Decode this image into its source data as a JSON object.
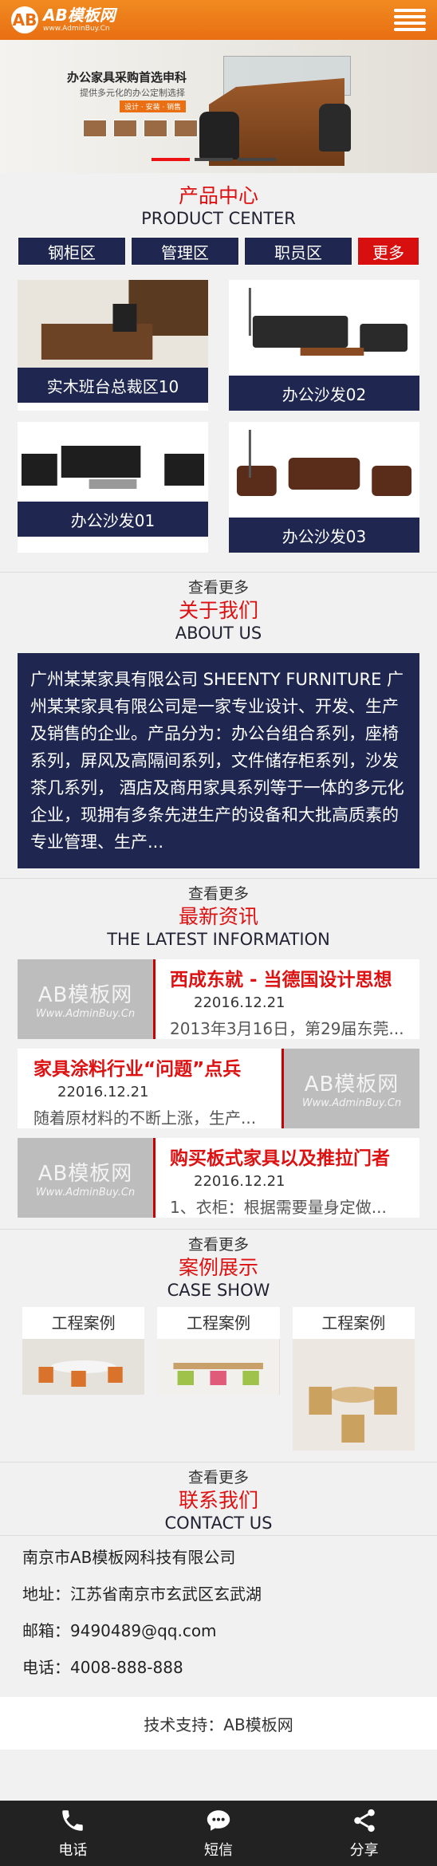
{
  "header": {
    "logo_mark": "AB",
    "logo_title": "AB模板网",
    "logo_sub": "www.AdminBuy.Cn"
  },
  "banner": {
    "title": "办公家具采购首选申科",
    "subtitle": "提供多元化的办公定制选择",
    "tag": "设计 · 安装 · 销售"
  },
  "products": {
    "title_cn": "产品中心",
    "title_en": "PRODUCT CENTER",
    "categories": [
      "钢柜区",
      "管理区",
      "职员区"
    ],
    "more_label": "更多",
    "items": [
      {
        "caption": "实木班台总裁区10"
      },
      {
        "caption": "办公沙发02"
      },
      {
        "caption": "办公沙发01"
      },
      {
        "caption": "办公沙发03"
      }
    ],
    "view_more": "查看更多"
  },
  "about": {
    "title_cn": "关于我们",
    "title_en": "ABOUT US",
    "text": "广州某某家具有限公司 SHEENTY FURNITURE 广州某某家具有限公司是一家专业设计、开发、生产及销售的企业。产品分为：办公台组合系列，座椅系列，屏风及高隔间系列，文件储存柜系列，沙发茶几系列， 酒店及商用家具系列等于一体的多元化企业，现拥有多条先进生产的设备和大批高质素的专业管理、生产...",
    "view_more": "查看更多"
  },
  "news": {
    "title_cn": "最新资讯",
    "title_en": "THE LATEST INFORMATION",
    "thumb_text": "AB模板网",
    "thumb_sub": "Www.AdminBuy.Cn",
    "items": [
      {
        "title": "西成东就 - 当德国设计思想",
        "date": "22016.12.21",
        "desc": "2013年3月16日，第29届东莞..."
      },
      {
        "title": "家具涂料行业“问题”点兵",
        "date": "22016.12.21",
        "desc": "随着原材料的不断上涨，生产..."
      },
      {
        "title": "购买板式家具以及推拉门者",
        "date": "22016.12.21",
        "desc": "1、衣柜：根据需要量身定做..."
      }
    ],
    "view_more": "查看更多"
  },
  "cases": {
    "title_cn": "案例展示",
    "title_en": "CASE SHOW",
    "items": [
      {
        "label": "工程案例"
      },
      {
        "label": "工程案例"
      },
      {
        "label": "工程案例"
      }
    ],
    "view_more": "查看更多"
  },
  "contact": {
    "title_cn": "联系我们",
    "title_en": "CONTACT US",
    "company": "南京市AB模板网科技有限公司",
    "address": "地址：江苏省南京市玄武区玄武湖",
    "email": "邮箱：9490489@qq.com",
    "phone": "电话：4008-888-888"
  },
  "footer": {
    "support": "技术支持：AB模板网"
  },
  "bottom_bar": {
    "tabs": [
      {
        "label": "电话",
        "icon": "phone-icon"
      },
      {
        "label": "短信",
        "icon": "chat-icon"
      },
      {
        "label": "分享",
        "icon": "share-icon"
      }
    ]
  },
  "colors": {
    "header": "#e96f12",
    "navy": "#1f2750",
    "accent_red": "#d11111",
    "bottom_bar": "#222222"
  }
}
